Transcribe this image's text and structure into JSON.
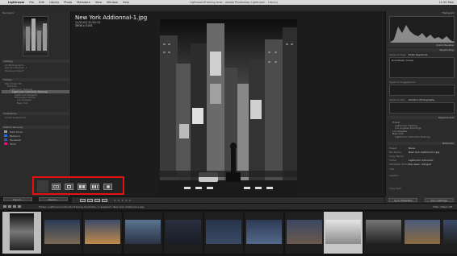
{
  "menubar": {
    "apple": "",
    "items": [
      "Lightroom",
      "File",
      "Edit",
      "Library",
      "Photo",
      "Metadata",
      "View",
      "Window",
      "Help"
    ],
    "window_title": "LightroomTraining.lrcat - Adobe Photoshop Lightroom - Library",
    "clock": "11:50 Mon"
  },
  "left_panel": {
    "navigator_label": "Navigator",
    "catalog_label": "Catalog",
    "catalog_rows": [
      {
        "label": "All Photographs",
        "count": ""
      },
      {
        "label": "Quick Collection +",
        "count": ""
      },
      {
        "label": "Previous Import",
        "count": ""
      }
    ],
    "folders_label": "Folders",
    "folder_rows": [
      {
        "label": "Macintosh HD",
        "count": "",
        "selected": false
      },
      {
        "label": "Pictures",
        "count": "",
        "selected": false
      },
      {
        "label": "Lightroom Training",
        "count": "",
        "selected": false
      },
      {
        "label": "Lightroom Instructor Training",
        "count": "",
        "selected": true
      },
      {
        "label": "Lightroom Projects",
        "count": "",
        "selected": false
      },
      {
        "label": "Processed Photos",
        "count": "",
        "selected": false
      },
      {
        "label": "Los Angeles",
        "count": "",
        "selected": false
      },
      {
        "label": "New York",
        "count": "",
        "selected": false
      }
    ],
    "collections_label": "Collections",
    "collection_rows": [
      {
        "label": "Smart Collections",
        "count": ""
      }
    ],
    "publish_label": "Publish Services",
    "services": [
      {
        "label": "Hard Drive",
        "color": "#9a9a9a"
      },
      {
        "label": "Behance",
        "color": "#1769ff"
      },
      {
        "label": "Facebook",
        "color": "#3b5998"
      },
      {
        "label": "Flickr",
        "color": "#ff0084"
      }
    ],
    "import_button": "Import...",
    "export_button": "Export..."
  },
  "center": {
    "filename": "New York Addionnal-1.jpg",
    "datetime": "11/11/12 22:51:21",
    "dimensions": "3906 x 5193",
    "toolbar_stars": "★ ★ ★ ★ ★"
  },
  "right_panel": {
    "histogram_label": "Histogram",
    "quick_develop_label": "Quick Develop",
    "keywording_label": "Keywording",
    "keyword_tags_label": "Keyword Tags",
    "keyword_tags_value": "Enter Keywords",
    "keyword_area_text": "Rockefeller Center",
    "keyword_suggestions_label": "Keyword Suggestions",
    "keyword_set_label": "Keyword Set",
    "keyword_set_value": "Outdoor Photography",
    "keyword_list_label": "Keyword List",
    "keyword_list_items": [
      "Travel",
      "Lightroom Training",
      "Los Angeles Buildings",
      "Los Angeles",
      "New York",
      "Lightroom Instructor Training"
    ],
    "metadata_label": "Metadata",
    "metadata_fields": [
      {
        "label": "Preset",
        "value": "None"
      },
      {
        "label": "File Name",
        "value": "New York Addionnal-1.jpg"
      },
      {
        "label": "Copy Name",
        "value": ""
      },
      {
        "label": "Folder",
        "value": "Lightroom Instructor"
      },
      {
        "label": "Metadata Status",
        "value": "Has been changed"
      },
      {
        "label": "Title",
        "value": ""
      },
      {
        "label": "Caption",
        "value": ""
      },
      {
        "label": "Copyright",
        "value": ""
      }
    ],
    "sync_button": "Sync Metadata",
    "sync_settings_button": "Sync Settings"
  },
  "filmstrip": {
    "path": "Folder: Lightroom Instructor Training   79 photos / 1 selected / New York Addionnal-1.jpg",
    "filter_label": "Filter:",
    "filter_value": "Filters Off"
  },
  "colors": {
    "highlight": "#e51010",
    "panel": "#2b2b2b",
    "selection": "#5a5a5a"
  }
}
